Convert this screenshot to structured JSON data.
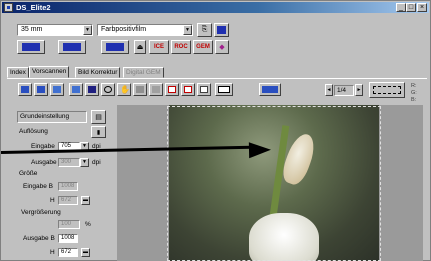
{
  "window": {
    "title": "DS_Elite2"
  },
  "toolbar": {
    "film_format": "35 mm",
    "film_type": "Farbpositivfilm",
    "badges": [
      "ICE",
      "ROC",
      "GEM"
    ]
  },
  "tabs": [
    "Index",
    "Vorscannen",
    "Bild Korrektur",
    "Digital GEM"
  ],
  "active_tab": 1,
  "frame_counter": "1/4",
  "rgb_labels": [
    "R:",
    "G:",
    "B:"
  ],
  "settings": {
    "preset": "Grundeinstellung",
    "aufloesung_label": "Auflösung",
    "eingabe_label": "Eingabe",
    "eingabe_value": "705",
    "dpi_unit": "dpi",
    "ausgabe_label": "Ausgabe",
    "ausgabe_value": "300",
    "groesse_label": "Größe",
    "eingabe_b_label": "Eingabe B",
    "eingabe_b_value": "1008",
    "eingabe_h_label": "H",
    "eingabe_h_value": "672",
    "vergroesserung_label": "Vergrößerung",
    "vergroesserung_value": "100",
    "percent_unit": "%",
    "ausgabe_b_label": "Ausgabe B",
    "ausgabe_b_value": "1008",
    "ausgabe_h_label": "H",
    "ausgabe_h_value": "672"
  },
  "colors": {
    "title_start": "#0a246a",
    "title_end": "#a6caf0",
    "badge_red": "#c00000"
  }
}
